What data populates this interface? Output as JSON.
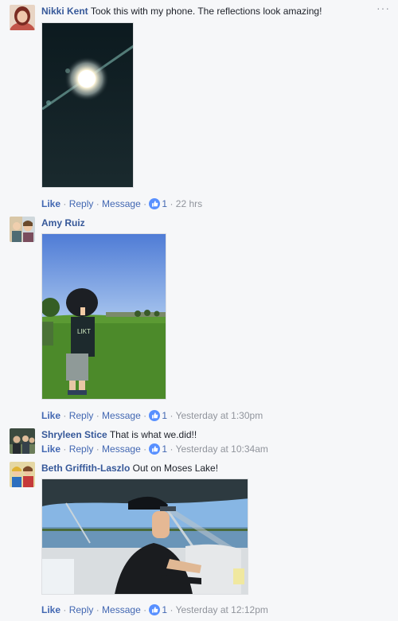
{
  "menu": {
    "more": "···"
  },
  "comments": [
    {
      "author": "Nikki Kent",
      "text": "Took this with my phone. The reflections look amazing!",
      "actions": {
        "like": "Like",
        "reply": "Reply",
        "message": "Message",
        "count": "1",
        "time": "22 hrs"
      }
    },
    {
      "author": "Amy Ruiz",
      "text": "",
      "actions": {
        "like": "Like",
        "reply": "Reply",
        "message": "Message",
        "count": "1",
        "time": "Yesterday at 1:30pm"
      }
    },
    {
      "author": "Shryleen Stice",
      "text": "That is what we.did!!",
      "actions": {
        "like": "Like",
        "reply": "Reply",
        "message": "Message",
        "count": "1",
        "time": "Yesterday at 10:34am"
      }
    },
    {
      "author": "Beth Griffith-Laszlo",
      "text": "Out on Moses Lake!",
      "actions": {
        "like": "Like",
        "reply": "Reply",
        "message": "Message",
        "count": "1",
        "time": "Yesterday at 12:12pm"
      }
    }
  ],
  "separator": " · ",
  "colors": {
    "link": "#365899",
    "action": "#4267b2",
    "meta": "#90949c",
    "like_badge": "#5890ff",
    "background": "#f6f7f9"
  },
  "icons": {
    "like_badge": "thumbs-up-icon",
    "more": "more-options-icon"
  }
}
